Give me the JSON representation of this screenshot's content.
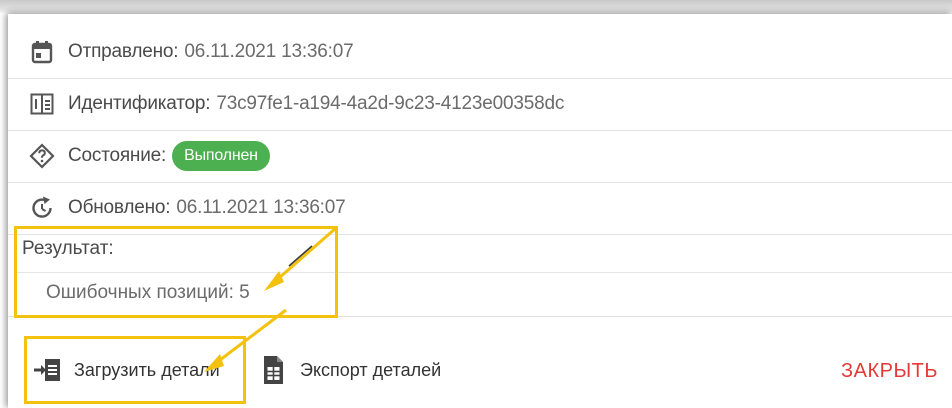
{
  "details": {
    "sent": {
      "label": "Отправлено:",
      "value": "06.11.2021 13:36:07",
      "icon": "calendar-icon"
    },
    "id": {
      "label": "Идентификатор:",
      "value": "73c97fe1-a194-4a2d-9c23-4123e00358dc",
      "icon": "identifier-icon"
    },
    "state": {
      "label": "Состояние:",
      "badge": "Выполнен",
      "badge_color": "#4caf50",
      "icon": "question-diamond-icon"
    },
    "updated": {
      "label": "Обновлено:",
      "value": "06.11.2021 13:36:07",
      "icon": "refresh-clock-icon"
    }
  },
  "result": {
    "title": "Результат:",
    "line": "Ошибочных позиций: 5"
  },
  "footer": {
    "load_label": "Загрузить детали",
    "export_label": "Экспорт деталей",
    "close_label": "ЗАКРЫТЬ",
    "close_color": "#e53935"
  },
  "annotations": {
    "highlight_color": "#f3c20f"
  }
}
